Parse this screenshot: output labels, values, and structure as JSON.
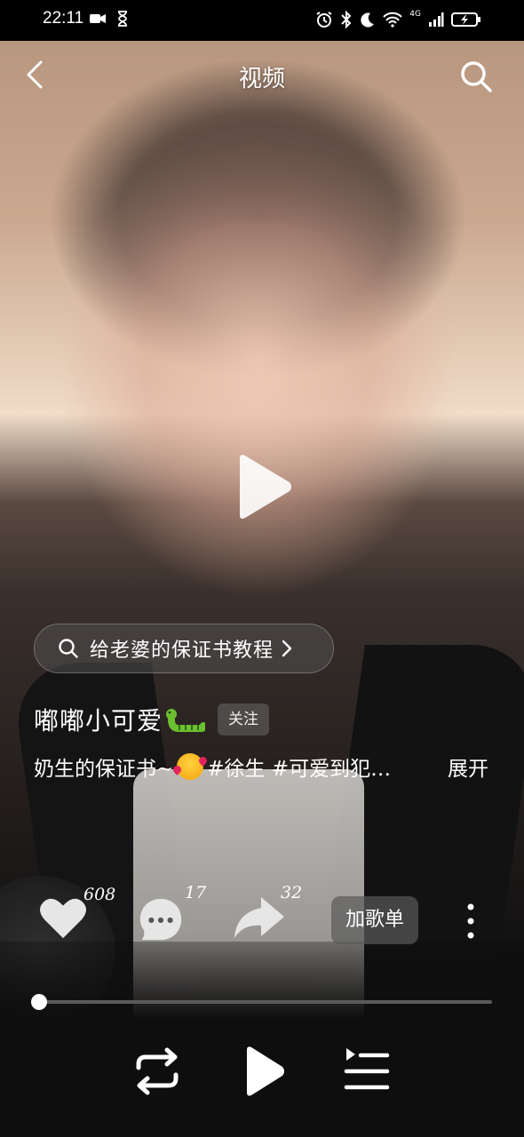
{
  "status_bar": {
    "time": "22:11",
    "network": "4G"
  },
  "nav": {
    "title": "视频"
  },
  "search_chip": {
    "text": "给老婆的保证书教程"
  },
  "author": {
    "name": "嘟嘟小可爱",
    "follow_label": "关注"
  },
  "description": {
    "prefix": "奶生的保证书~",
    "suffix": "#徐生 #可爱到犯…",
    "expand_label": "展开"
  },
  "actions": {
    "like_count": "608",
    "comment_count": "17",
    "share_count": "32",
    "playlist_label": "加歌单"
  },
  "playback": {
    "progress": 0.0
  },
  "icons": {
    "back": "chevron-left-icon",
    "search": "search-icon",
    "like": "heart-icon",
    "comment": "comment-bubble-icon",
    "share": "share-arrow-icon",
    "more": "more-vertical-icon",
    "repeat": "repeat-icon",
    "play": "play-icon",
    "queue": "playlist-queue-icon"
  }
}
